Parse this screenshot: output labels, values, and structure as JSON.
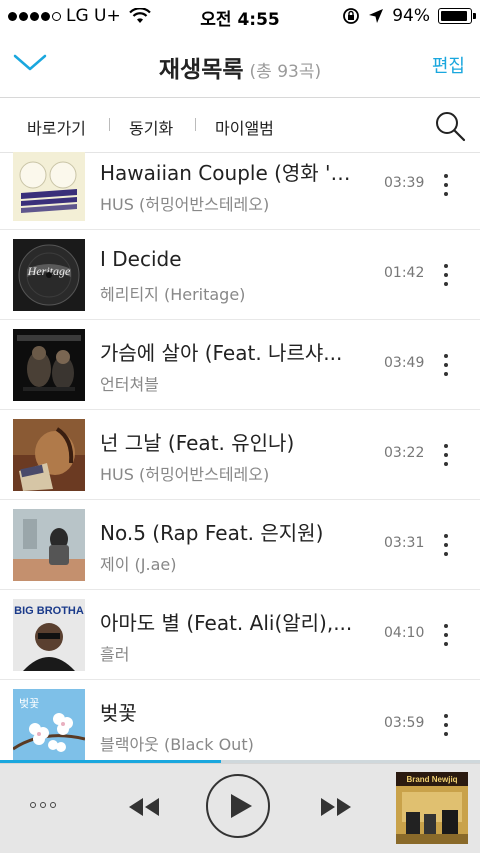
{
  "status_bar": {
    "carrier": "LG U+",
    "time": "오전 4:55",
    "battery": "94%",
    "battery_level": 0.94
  },
  "header": {
    "title": "재생목록",
    "count": "(총 93곡)",
    "edit": "편집"
  },
  "subnav": {
    "items": [
      "바로가기",
      "동기화",
      "마이앨범"
    ]
  },
  "songs": [
    {
      "title": "Hawaiian Couple (영화 '…",
      "artist": "HUS (허밍어반스테레오)",
      "duration": "03:39"
    },
    {
      "title": "I Decide",
      "artist": "헤리티지 (Heritage)",
      "duration": "01:42"
    },
    {
      "title": "가슴에 살아 (Feat. 나르샤...",
      "artist": "언터쳐블",
      "duration": "03:49"
    },
    {
      "title": "넌 그날 (Feat. 유인나)",
      "artist": "HUS (허밍어반스테레오)",
      "duration": "03:22"
    },
    {
      "title": "No.5 (Rap Feat. 은지원)",
      "artist": "제이 (J.ae)",
      "duration": "03:31"
    },
    {
      "title": "아마도 별 (Feat. Ali(알리),...",
      "artist": "흘러",
      "duration": "04:10"
    },
    {
      "title": "벚꽃",
      "artist": "블랙아웃 (Black Out)",
      "duration": "03:59"
    }
  ],
  "album_art": {
    "heritage_text": "Heritage",
    "bigbrotha_text": "BIG BROTHA",
    "blossom_text": "벚꽃",
    "nowplaying_text": "Brand Newjiq"
  },
  "player": {
    "progress": 0.46,
    "accent": "#1aa7de"
  },
  "icons": {
    "back": "chevron-down-icon",
    "search": "search-icon",
    "more": "more-vertical-icon",
    "prev": "rewind-icon",
    "play": "play-icon",
    "next": "fast-forward-icon"
  }
}
